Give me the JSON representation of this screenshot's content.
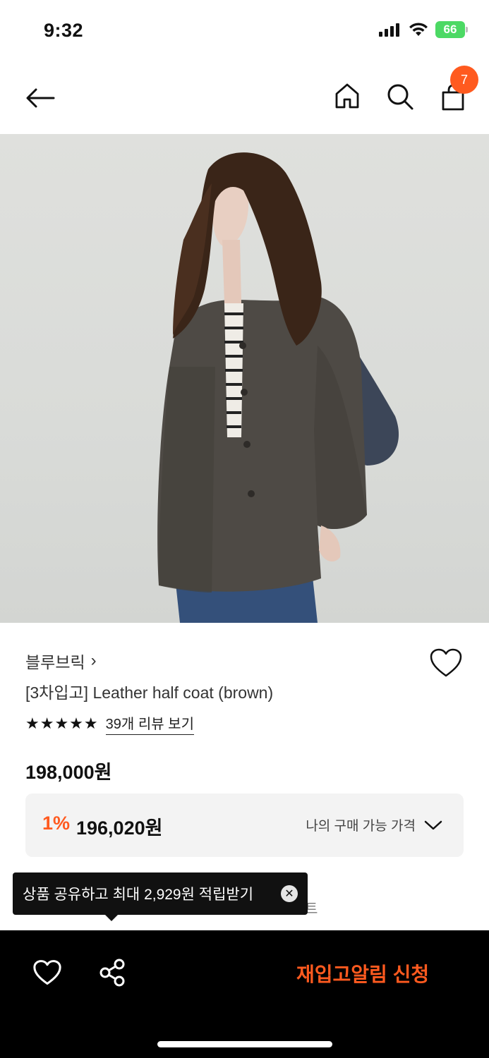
{
  "status_bar": {
    "time": "9:32",
    "battery": "66"
  },
  "header": {
    "back_icon": "arrow-left-icon",
    "home_icon": "home-icon",
    "search_icon": "search-icon",
    "cart_icon": "shopping-bag-icon",
    "cart_count": "7"
  },
  "product": {
    "brand": "블루브릭",
    "brand_chevron": "›",
    "title": "[3차입고] Leather half coat (brown)",
    "rating_stars": "★★★★★",
    "review_link": "39개 리뷰 보기",
    "price": "198,000원",
    "discount_percent": "1%",
    "discount_price": "196,020원",
    "my_price_label": "나의 구매 가능 가격"
  },
  "tooltip": {
    "text": "상품 공유하고 최대 2,929원 적립받기",
    "close": "✕",
    "behind_text": "트"
  },
  "bottom_bar": {
    "wish_icon": "heart-icon",
    "share_icon": "share-icon",
    "restock_label": "재입고알림 신청"
  },
  "colors": {
    "accent": "#ff5a1f",
    "bar": "#000000",
    "box": "#f3f3f3"
  }
}
